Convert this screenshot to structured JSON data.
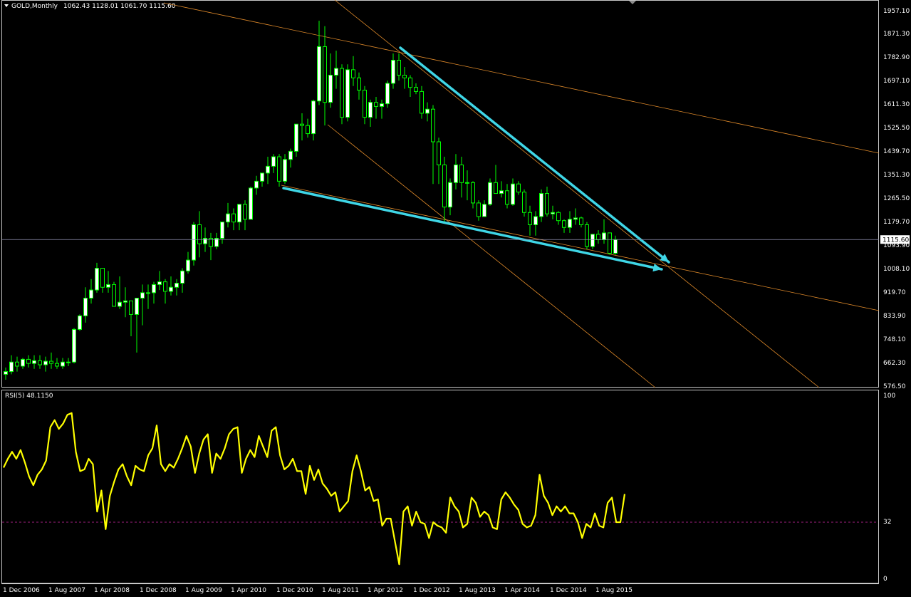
{
  "header": {
    "menu_arrow": "triangle-down-icon",
    "title": "GOLD,Monthly",
    "ohlc": "1062.43 1128.01 1061.70 1115.60"
  },
  "colors": {
    "background": "#000000",
    "frame": "#c8c8c8",
    "bull_body": "#ffffff",
    "bear_body": "#000000",
    "candle_outline": "#00ff00",
    "trendline_orange": "#e08a2a",
    "arrow_cyan": "#3fd6e6",
    "price_line": "#8f8fb0",
    "rsi_line": "#ffff00",
    "rsi_level": "#a02080"
  },
  "chart_data": [
    {
      "type": "candlestick",
      "symbol": "GOLD",
      "timeframe": "Monthly",
      "ylim": [
        576.5,
        1957.1
      ],
      "y_ticks": [
        "1957.10",
        "1871.30",
        "1782.90",
        "1697.10",
        "1611.30",
        "1525.50",
        "1439.70",
        "1351.30",
        "1265.50",
        "1179.70",
        "1093.90",
        "1008.10",
        "919.70",
        "833.90",
        "748.10",
        "662.30",
        "576.50"
      ],
      "current_price": "1115.60",
      "x_ticks": [
        "1 Dec 2006",
        "1 Aug 2007",
        "1 Apr 2008",
        "1 Dec 2008",
        "1 Aug 2009",
        "1 Apr 2010",
        "1 Dec 2010",
        "1 Aug 2011",
        "1 Apr 2012",
        "1 Dec 2012",
        "1 Aug 2013",
        "1 Apr 2014",
        "1 Dec 2014",
        "1 Aug 2015"
      ],
      "ohlc": [
        [
          620,
          645,
          600,
          630
        ],
        [
          630,
          690,
          620,
          665
        ],
        [
          665,
          685,
          630,
          650
        ],
        [
          650,
          680,
          640,
          675
        ],
        [
          675,
          690,
          645,
          660
        ],
        [
          660,
          690,
          640,
          670
        ],
        [
          670,
          690,
          640,
          655
        ],
        [
          655,
          685,
          630,
          668
        ],
        [
          668,
          700,
          640,
          660
        ],
        [
          660,
          680,
          640,
          650
        ],
        [
          650,
          680,
          640,
          665
        ],
        [
          665,
          680,
          650,
          665
        ],
        [
          665,
          790,
          660,
          785
        ],
        [
          785,
          840,
          780,
          835
        ],
        [
          835,
          940,
          810,
          900
        ],
        [
          900,
          970,
          880,
          930
        ],
        [
          930,
          1030,
          920,
          1010
        ],
        [
          1010,
          1010,
          920,
          940
        ],
        [
          940,
          1000,
          920,
          950
        ],
        [
          950,
          960,
          900,
          870
        ],
        [
          870,
          980,
          860,
          885
        ],
        [
          885,
          940,
          830,
          890
        ],
        [
          890,
          850,
          760,
          840
        ],
        [
          840,
          900,
          700,
          900
        ],
        [
          900,
          950,
          800,
          920
        ],
        [
          920,
          950,
          860,
          920
        ],
        [
          920,
          960,
          880,
          950
        ],
        [
          950,
          1000,
          930,
          960
        ],
        [
          960,
          970,
          880,
          925
        ],
        [
          925,
          980,
          910,
          940
        ],
        [
          940,
          970,
          910,
          955
        ],
        [
          955,
          1010,
          920,
          1000
        ],
        [
          1000,
          1070,
          990,
          1040
        ],
        [
          1040,
          1180,
          1020,
          1170
        ],
        [
          1170,
          1220,
          1050,
          1100
        ],
        [
          1100,
          1160,
          1070,
          1120
        ],
        [
          1120,
          1140,
          1040,
          1090
        ],
        [
          1090,
          1140,
          1080,
          1120
        ],
        [
          1120,
          1180,
          1100,
          1180
        ],
        [
          1180,
          1250,
          1160,
          1210
        ],
        [
          1210,
          1230,
          1150,
          1180
        ],
        [
          1180,
          1210,
          1150,
          1245
        ],
        [
          1245,
          1260,
          1150,
          1190
        ],
        [
          1190,
          1310,
          1190,
          1305
        ],
        [
          1305,
          1350,
          1280,
          1330
        ],
        [
          1330,
          1360,
          1310,
          1360
        ],
        [
          1360,
          1420,
          1320,
          1385
        ],
        [
          1385,
          1430,
          1360,
          1420
        ],
        [
          1420,
          1430,
          1310,
          1330
        ],
        [
          1330,
          1430,
          1320,
          1410
        ],
        [
          1410,
          1450,
          1380,
          1440
        ],
        [
          1440,
          1520,
          1420,
          1540
        ],
        [
          1540,
          1580,
          1480,
          1535
        ],
        [
          1535,
          1560,
          1490,
          1505
        ],
        [
          1505,
          1630,
          1480,
          1625
        ],
        [
          1625,
          1920,
          1610,
          1825
        ],
        [
          1825,
          1900,
          1535,
          1620
        ],
        [
          1620,
          1800,
          1600,
          1720
        ],
        [
          1720,
          1810,
          1670,
          1745
        ],
        [
          1745,
          1760,
          1540,
          1565
        ],
        [
          1565,
          1760,
          1550,
          1740
        ],
        [
          1740,
          1790,
          1680,
          1710
        ],
        [
          1710,
          1730,
          1630,
          1665
        ],
        [
          1665,
          1680,
          1540,
          1565
        ],
        [
          1565,
          1630,
          1530,
          1620
        ],
        [
          1620,
          1640,
          1560,
          1605
        ],
        [
          1605,
          1630,
          1560,
          1615
        ],
        [
          1615,
          1700,
          1600,
          1690
        ],
        [
          1690,
          1800,
          1670,
          1775
        ],
        [
          1775,
          1800,
          1700,
          1720
        ],
        [
          1720,
          1750,
          1670,
          1710
        ],
        [
          1710,
          1720,
          1640,
          1675
        ],
        [
          1675,
          1690,
          1650,
          1660
        ],
        [
          1660,
          1680,
          1560,
          1580
        ],
        [
          1580,
          1620,
          1550,
          1595
        ],
        [
          1595,
          1610,
          1320,
          1475
        ],
        [
          1475,
          1490,
          1320,
          1390
        ],
        [
          1390,
          1420,
          1180,
          1235
        ],
        [
          1235,
          1340,
          1205,
          1325
        ],
        [
          1325,
          1430,
          1300,
          1390
        ],
        [
          1390,
          1420,
          1270,
          1325
        ],
        [
          1325,
          1370,
          1260,
          1325
        ],
        [
          1325,
          1330,
          1230,
          1250
        ],
        [
          1250,
          1260,
          1185,
          1200
        ],
        [
          1200,
          1260,
          1200,
          1245
        ],
        [
          1245,
          1340,
          1240,
          1325
        ],
        [
          1325,
          1390,
          1300,
          1285
        ],
        [
          1285,
          1330,
          1270,
          1295
        ],
        [
          1295,
          1320,
          1230,
          1245
        ],
        [
          1245,
          1340,
          1240,
          1320
        ],
        [
          1320,
          1330,
          1280,
          1290
        ],
        [
          1290,
          1300,
          1200,
          1215
        ],
        [
          1215,
          1240,
          1130,
          1170
        ],
        [
          1170,
          1220,
          1130,
          1200
        ],
        [
          1200,
          1300,
          1180,
          1285
        ],
        [
          1285,
          1310,
          1200,
          1210
        ],
        [
          1210,
          1240,
          1190,
          1215
        ],
        [
          1215,
          1220,
          1170,
          1185
        ],
        [
          1185,
          1190,
          1140,
          1160
        ],
        [
          1160,
          1220,
          1140,
          1190
        ],
        [
          1190,
          1230,
          1170,
          1195
        ],
        [
          1195,
          1200,
          1160,
          1170
        ],
        [
          1170,
          1180,
          1080,
          1090
        ],
        [
          1090,
          1130,
          1080,
          1135
        ],
        [
          1135,
          1150,
          1100,
          1115
        ],
        [
          1115,
          1190,
          1100,
          1140
        ],
        [
          1140,
          1140,
          1060,
          1065
        ],
        [
          1065,
          1130,
          1060,
          1115
        ]
      ]
    },
    {
      "type": "line",
      "indicator": "RSI(5)",
      "value_text": "48.1150",
      "ylim": [
        0,
        100
      ],
      "y_ticks": [
        "100",
        "32",
        "0"
      ],
      "level": 32,
      "values": [
        63,
        68,
        72,
        68,
        73,
        66,
        58,
        53,
        59,
        62,
        67,
        86,
        90,
        85,
        88,
        93,
        94,
        72,
        61,
        62,
        68,
        65,
        38,
        50,
        28,
        47,
        55,
        62,
        65,
        58,
        53,
        64,
        62,
        61,
        70,
        74,
        87,
        65,
        61,
        65,
        63,
        68,
        74,
        81,
        75,
        60,
        71,
        79,
        82,
        60,
        71,
        68,
        74,
        82,
        85,
        86,
        60,
        68,
        73,
        69,
        81,
        75,
        69,
        84,
        86,
        70,
        62,
        64,
        68,
        61,
        61,
        48,
        64,
        56,
        62,
        54,
        51,
        47,
        49,
        38,
        41,
        44,
        61,
        70,
        61,
        50,
        52,
        44,
        45,
        30,
        34,
        34,
        21,
        8,
        38,
        41,
        30,
        38,
        32,
        31,
        23,
        32,
        30,
        29,
        26,
        46,
        41,
        38,
        29,
        31,
        46,
        43,
        35,
        38,
        36,
        29,
        28,
        45,
        49,
        46,
        42,
        39,
        31,
        29,
        30,
        36,
        59,
        47,
        43,
        36,
        41,
        38,
        41,
        37,
        37,
        32,
        23,
        31,
        29,
        37,
        30,
        29,
        43,
        46,
        32,
        32,
        48
      ]
    }
  ]
}
